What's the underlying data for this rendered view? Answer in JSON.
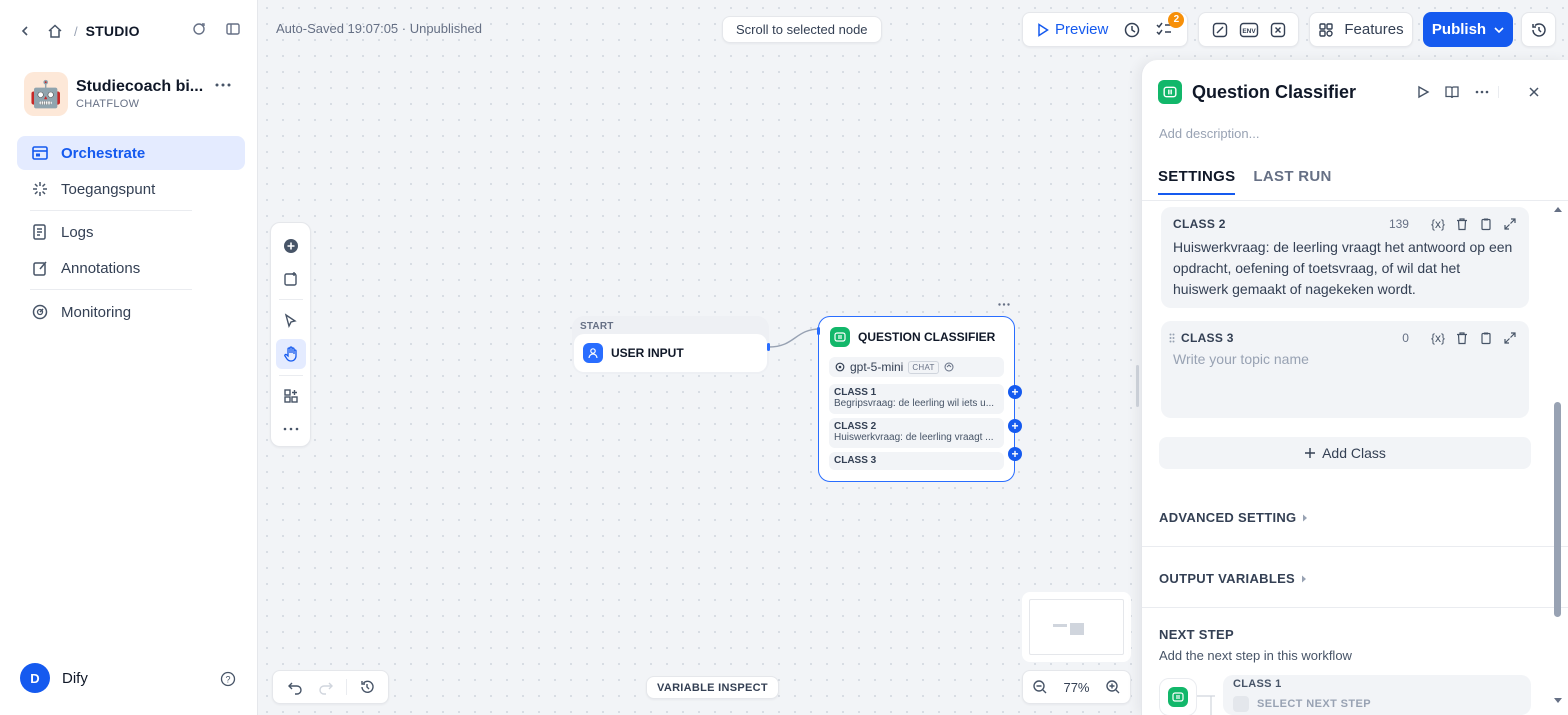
{
  "breadcrumb": {
    "label": "STUDIO"
  },
  "app": {
    "name": "Studiecoach bi...",
    "type": "CHATFLOW"
  },
  "nav": [
    {
      "label": "Orchestrate"
    },
    {
      "label": "Toegangspunt"
    },
    {
      "label": "Logs"
    },
    {
      "label": "Annotations"
    },
    {
      "label": "Monitoring"
    }
  ],
  "user": {
    "initial": "D",
    "name": "Dify"
  },
  "header": {
    "autosave": "Auto-Saved 19:07:05 · Unpublished",
    "scroll_to_selected": "Scroll to selected node",
    "preview": "Preview",
    "checklist_badge": "2",
    "env_label": "ENV",
    "features": "Features",
    "publish": "Publish"
  },
  "nodes": {
    "start": {
      "header": "START",
      "title": "USER INPUT"
    },
    "qc": {
      "title": "QUESTION CLASSIFIER",
      "model": "gpt-5-mini",
      "model_tag": "CHAT",
      "classes": [
        {
          "name": "CLASS 1",
          "desc": "Begripsvraag: de leerling wil iets u..."
        },
        {
          "name": "CLASS 2",
          "desc": "Huiswerkvraag: de leerling vraagt ..."
        },
        {
          "name": "CLASS 3",
          "desc": ""
        }
      ]
    }
  },
  "bottom": {
    "variable_inspect": "VARIABLE INSPECT",
    "zoom": "77%"
  },
  "panel": {
    "title": "Question Classifier",
    "description_placeholder": "Add description...",
    "tabs": [
      "SETTINGS",
      "LAST RUN"
    ],
    "class2": {
      "title": "CLASS 2",
      "count": "139",
      "text": "Huiswerkvraag: de leerling vraagt het antwoord op een opdracht, oefening of toetsvraag, of wil dat het huiswerk gemaakt of nagekeken wordt."
    },
    "class3": {
      "title": "CLASS 3",
      "count": "0",
      "placeholder": "Write your topic name"
    },
    "var_token": "{x}",
    "add_class": "Add Class",
    "advanced": "ADVANCED SETTING",
    "output": "OUTPUT VARIABLES",
    "next_step": {
      "title": "NEXT STEP",
      "subtitle": "Add the next step in this workflow",
      "branch": "CLASS 1",
      "select": "SELECT NEXT STEP"
    }
  }
}
